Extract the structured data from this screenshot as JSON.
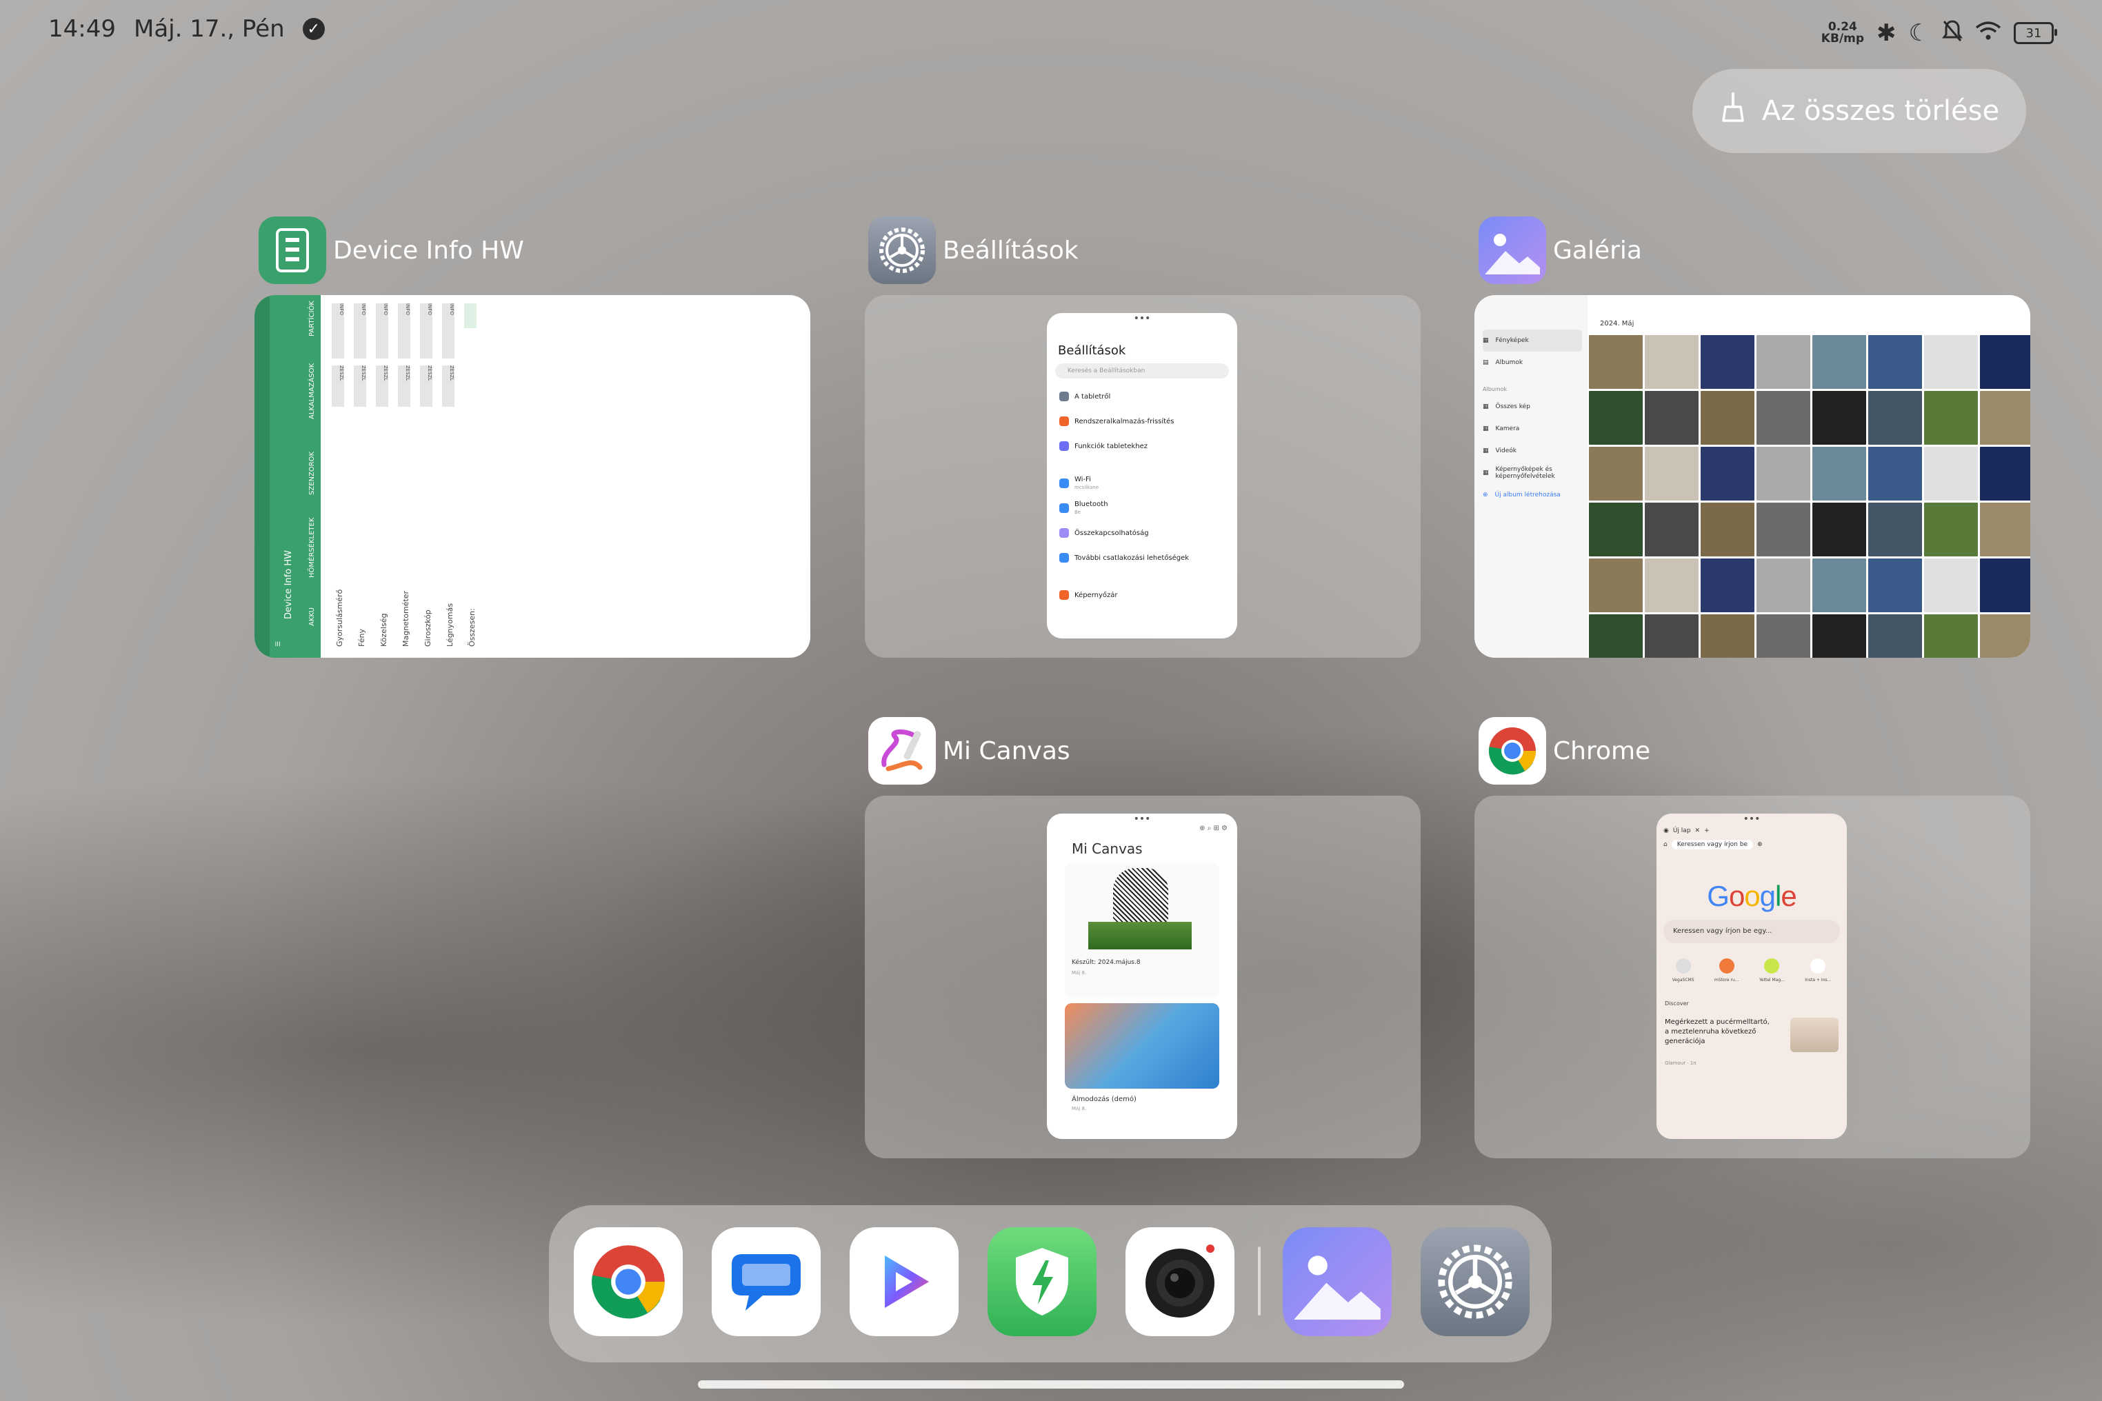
{
  "status_bar": {
    "time": "14:49",
    "date": "Máj. 17., Pén",
    "net_speed_value": "0.24",
    "net_speed_unit": "KB/mp",
    "battery": "31",
    "icons": [
      "check-circle-icon",
      "bluetooth-icon",
      "moon-icon",
      "bell-off-icon",
      "wifi-icon",
      "battery-icon"
    ]
  },
  "clear_all": {
    "label": "Az összes törlése",
    "icon": "broom-icon"
  },
  "recents": [
    {
      "app": "Device Info HW",
      "icon": "device-info-icon"
    },
    {
      "app": "Beállítások",
      "icon": "settings-gear-icon"
    },
    {
      "app": "Galéria",
      "icon": "gallery-icon"
    },
    {
      "app": "Mi Canvas",
      "icon": "mi-canvas-icon"
    },
    {
      "app": "Chrome",
      "icon": "chrome-icon"
    }
  ],
  "device_info": {
    "app_title": "Device Info HW",
    "tabs": [
      "AKKU",
      "HŐMÉRSÉKLETEK",
      "SZENZOROK",
      "ALKALMAZÁSOK",
      "PARTÍCIÓK"
    ],
    "column_labels": [
      "INFO",
      "ZESZL"
    ],
    "sensors": [
      "Gyorsulásmérő",
      "Fény",
      "Közelség",
      "Magnetométer",
      "Giroszkóp",
      "Légnyomás",
      "Összesen:"
    ]
  },
  "settings_preview": {
    "title": "Beállítások",
    "search_placeholder": "Keresés a Beállításokban",
    "items": [
      {
        "label": "A tabletről",
        "sub": ""
      },
      {
        "label": "Rendszeralkalmazás-frissítés",
        "sub": ""
      },
      {
        "label": "Funkciók tabletekhez",
        "sub": ""
      },
      {
        "label": "Wi-Fi",
        "sub": "mcsilkane"
      },
      {
        "label": "Bluetooth",
        "sub": "Be"
      },
      {
        "label": "Összekapcsolhatóság",
        "sub": ""
      },
      {
        "label": "További csatlakozási lehetőségek",
        "sub": ""
      },
      {
        "label": "Képernyőzár",
        "sub": ""
      }
    ]
  },
  "gallery_preview": {
    "date": "2024. Máj",
    "side_items": [
      "Fényképek",
      "Albumok"
    ],
    "albums_header": "Albumok",
    "albums": [
      "Összes kép",
      "Kamera",
      "Videók",
      "Képernyőképek és képernyőfelvételek"
    ],
    "new_album": "Új album létrehozása"
  },
  "mi_canvas_preview": {
    "title": "Mi Canvas",
    "note1_title": "Készült: 2024.május.8",
    "note1_date": "Máj 8.",
    "note2_title": "Álmodozás (demó)",
    "note2_date": "Máj 8."
  },
  "chrome_preview": {
    "tab": "Új lap",
    "omnibox": "Keressen vagy írjon be",
    "logo": "Google",
    "search": "Keressen vagy írjon be egy...",
    "shortcuts": [
      "VegaSCMS",
      "mStore ru...",
      "Yettel Mag...",
      "Insta + Ins..."
    ],
    "discover": "Discover",
    "article": "Megérkezett a pucérmelltartó, a meztelenruha következő generációja",
    "source": "Glamour · 1n"
  },
  "dock": {
    "apps": [
      "Chrome",
      "Messages",
      "Video player",
      "Security",
      "Camera",
      "Galéria",
      "Beállítások"
    ]
  }
}
